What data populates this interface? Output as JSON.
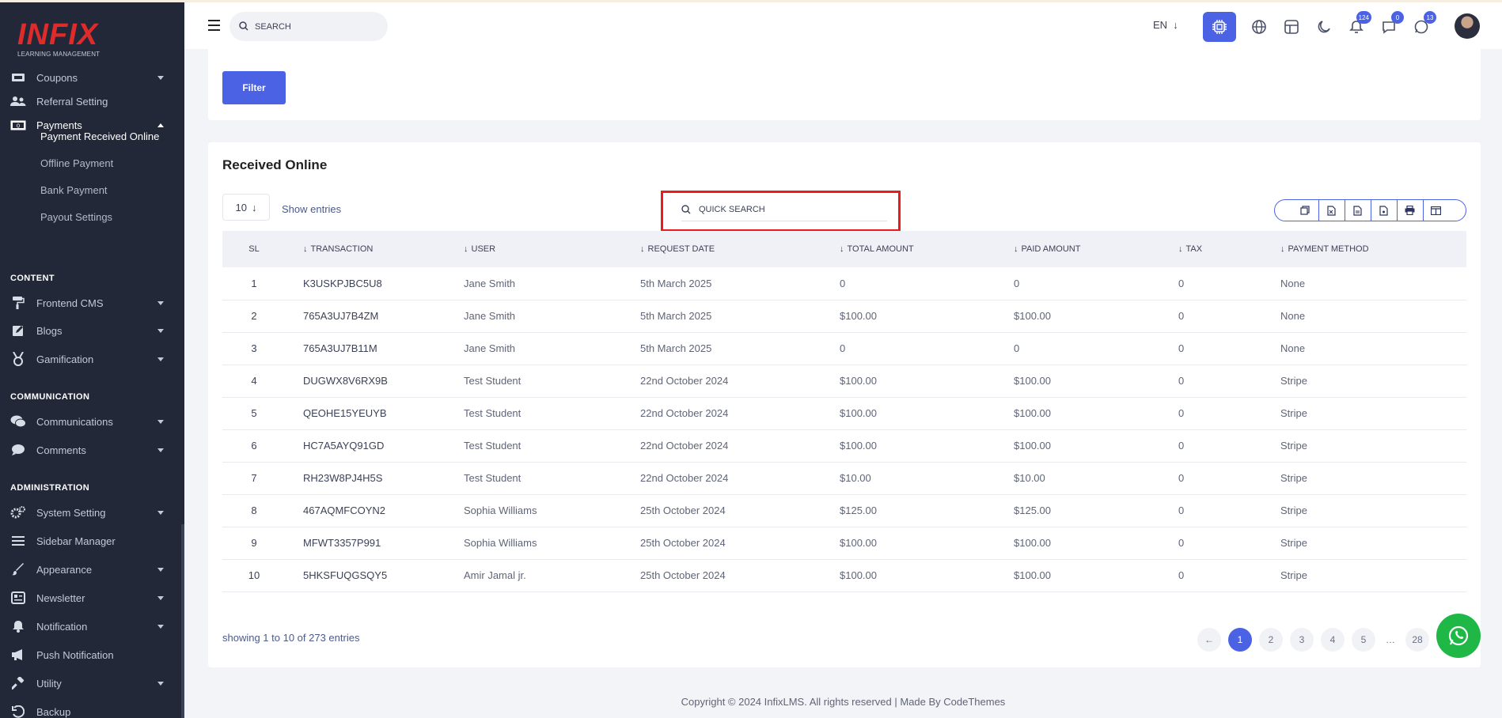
{
  "brand": {
    "logo": "INFIX",
    "logo_sub": "LEARNING MANAGEMENT"
  },
  "header": {
    "search_placeholder": "SEARCH",
    "language": "EN",
    "badges": {
      "notifications": "124",
      "messages": "0",
      "whatsapp": "13"
    }
  },
  "sidebar": {
    "items_top": [
      {
        "label": "Coupons",
        "icon": "ticket-icon",
        "caret": true
      },
      {
        "label": "Referral Setting",
        "icon": "users-icon",
        "caret": false
      },
      {
        "label": "Payments",
        "icon": "money-icon",
        "caret": true
      }
    ],
    "payments_sub": [
      "Payment Received Online",
      "Offline Payment",
      "Bank Payment",
      "Payout Settings"
    ],
    "section_content": "CONTENT",
    "items_content": [
      {
        "label": "Frontend CMS",
        "icon": "paint-roller-icon"
      },
      {
        "label": "Blogs",
        "icon": "edit-icon"
      },
      {
        "label": "Gamification",
        "icon": "medal-icon"
      }
    ],
    "section_communication": "COMMUNICATION",
    "items_communication": [
      {
        "label": "Communications",
        "icon": "chat-icon"
      },
      {
        "label": "Comments",
        "icon": "comment-icon"
      }
    ],
    "section_administration": "ADMINISTRATION",
    "items_admin": [
      {
        "label": "System Setting",
        "icon": "gears-icon"
      },
      {
        "label": "Sidebar Manager",
        "icon": "bars-icon"
      },
      {
        "label": "Appearance",
        "icon": "brush-icon"
      },
      {
        "label": "Newsletter",
        "icon": "newsletter-icon"
      },
      {
        "label": "Notification",
        "icon": "bell-icon"
      },
      {
        "label": "Push Notification",
        "icon": "megaphone-icon"
      },
      {
        "label": "Utility",
        "icon": "hammer-icon"
      },
      {
        "label": "Backup",
        "icon": "history-icon"
      }
    ]
  },
  "filter": {
    "button": "Filter"
  },
  "main": {
    "title": "Received Online",
    "entries_value": "10",
    "show_entries": "Show entries",
    "quick_search_placeholder": "QUICK SEARCH",
    "columns": [
      "SL",
      "TRANSACTION",
      "USER",
      "REQUEST DATE",
      "TOTAL AMOUNT",
      "PAID AMOUNT",
      "TAX",
      "PAYMENT METHOD"
    ],
    "rows": [
      [
        "1",
        "K3USKPJBC5U8",
        "Jane Smith",
        "5th March 2025",
        "0",
        "0",
        "0",
        "None"
      ],
      [
        "2",
        "765A3UJ7B4ZM",
        "Jane Smith",
        "5th March 2025",
        "$100.00",
        "$100.00",
        "0",
        "None"
      ],
      [
        "3",
        "765A3UJ7B11M",
        "Jane Smith",
        "5th March 2025",
        "0",
        "0",
        "0",
        "None"
      ],
      [
        "4",
        "DUGWX8V6RX9B",
        "Test Student",
        "22nd October 2024",
        "$100.00",
        "$100.00",
        "0",
        "Stripe"
      ],
      [
        "5",
        "QEOHE15YEUYB",
        "Test Student",
        "22nd October 2024",
        "$100.00",
        "$100.00",
        "0",
        "Stripe"
      ],
      [
        "6",
        "HC7A5AYQ91GD",
        "Test Student",
        "22nd October 2024",
        "$100.00",
        "$100.00",
        "0",
        "Stripe"
      ],
      [
        "7",
        "RH23W8PJ4H5S",
        "Test Student",
        "22nd October 2024",
        "$10.00",
        "$10.00",
        "0",
        "Stripe"
      ],
      [
        "8",
        "467AQMFCOYN2",
        "Sophia Williams",
        "25th October 2024",
        "$125.00",
        "$125.00",
        "0",
        "Stripe"
      ],
      [
        "9",
        "MFWT3357P991",
        "Sophia Williams",
        "25th October 2024",
        "$100.00",
        "$100.00",
        "0",
        "Stripe"
      ],
      [
        "10",
        "5HKSFUQGSQY5",
        "Amir Jamal jr.",
        "25th October 2024",
        "$100.00",
        "$100.00",
        "0",
        "Stripe"
      ]
    ],
    "showing": "showing 1 to 10 of 273 entries",
    "pages": [
      "1",
      "2",
      "3",
      "4",
      "5",
      "…",
      "28"
    ]
  },
  "footer": "Copyright © 2024 InfixLMS. All rights reserved | Made By CodeThemes",
  "colors": {
    "primary": "#4a62e3",
    "sidebar": "#222838",
    "highlight": "#e81c1c",
    "whatsapp": "#1fb847"
  }
}
